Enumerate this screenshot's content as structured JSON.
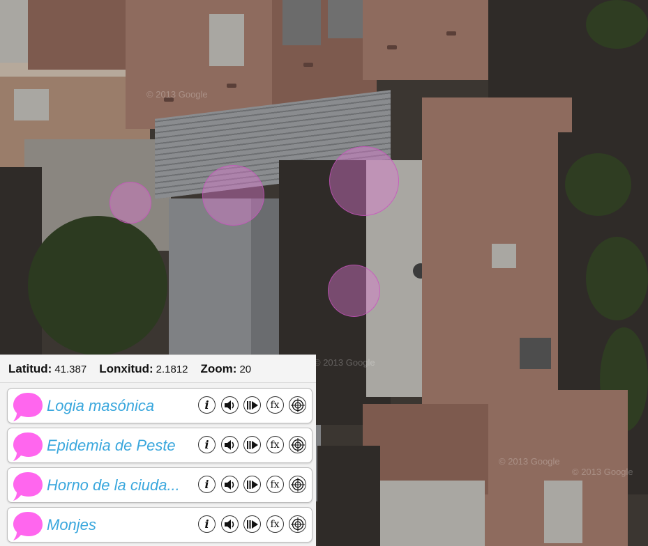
{
  "map": {
    "watermark": "© 2013 Google",
    "markers": [
      {
        "label": "poi-1"
      },
      {
        "label": "poi-2"
      },
      {
        "label": "poi-3"
      },
      {
        "label": "poi-4"
      }
    ]
  },
  "coords": {
    "lat_label": "Latitud:",
    "lat_value": "41.387",
    "lon_label": "Lonxitud:",
    "lon_value": "2.1812",
    "zoom_label": "Zoom:",
    "zoom_value": "20"
  },
  "layers": [
    {
      "name": "Logia masónica",
      "color": "#ff66ee"
    },
    {
      "name": "Epidemia de Peste",
      "color": "#ff66ee"
    },
    {
      "name": "Horno de la ciuda...",
      "color": "#ff66ee"
    },
    {
      "name": "Monjes",
      "color": "#ff66ee"
    }
  ],
  "layer_buttons": [
    "info-icon",
    "audio-icon",
    "play-icon",
    "fx-icon",
    "target-icon"
  ],
  "fx_label": "fx",
  "info_label": "i"
}
